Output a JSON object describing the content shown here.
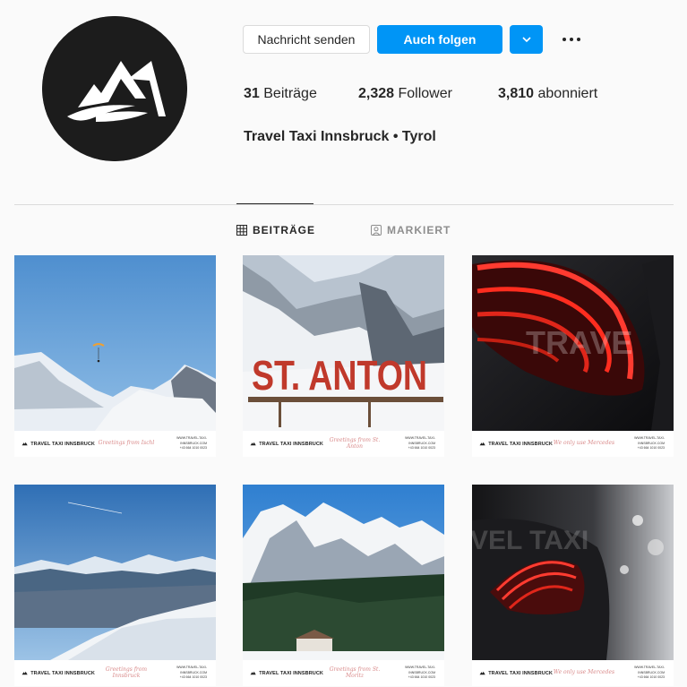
{
  "profile": {
    "avatar_icon": "mountain-logo-icon",
    "full_name": "Travel Taxi Innsbruck • Tyrol",
    "stats": {
      "posts_count": "31",
      "posts_label": "Beiträge",
      "followers_count": "2,328",
      "followers_label": "Follower",
      "following_count": "3,810",
      "following_label": "abonniert"
    }
  },
  "actions": {
    "message_label": "Nachricht senden",
    "follow_label": "Auch folgen",
    "dropdown_icon": "chevron-down-icon",
    "more_icon": "more-options-icon",
    "accent_color": "#0095f6"
  },
  "tabs": {
    "posts_label": "BEITRÄGE",
    "posts_icon": "grid-icon",
    "tagged_label": "MARKIERT",
    "tagged_icon": "tagged-user-icon"
  },
  "posts": [
    {
      "brand": "TRAVEL TAXI INNSBRUCK",
      "greeting": "Greetings from Ischl",
      "contact_1": "WWW.TRAVEL-TAXI-INNSBRUCK.COM",
      "contact_2": "+43 664 1010 0023"
    },
    {
      "sign_text": "ST. ANTON",
      "brand": "TRAVEL TAXI INNSBRUCK",
      "greeting": "Greetings from St. Anton",
      "contact_1": "WWW.TRAVEL-TAXI-INNSBRUCK.COM",
      "contact_2": "+43 664 1010 0023"
    },
    {
      "watermark": "TRAVE",
      "brand": "TRAVEL TAXI INNSBRUCK",
      "greeting": "We only use Mercedes",
      "contact_1": "WWW.TRAVEL-TAXI-INNSBRUCK.COM",
      "contact_2": "+43 664 1010 0023"
    },
    {
      "brand": "TRAVEL TAXI INNSBRUCK",
      "greeting": "Greetings from Innsbruck",
      "contact_1": "WWW.TRAVEL-TAXI-INNSBRUCK.COM",
      "contact_2": "+43 664 1010 0023"
    },
    {
      "brand": "TRAVEL TAXI INNSBRUCK",
      "greeting": "Greetings from St. Moritz",
      "contact_1": "WWW.TRAVEL-TAXI-INNSBRUCK.COM",
      "contact_2": "+43 664 1010 0023"
    },
    {
      "watermark": "VEL TAXI",
      "brand": "TRAVEL TAXI INNSBRUCK",
      "greeting": "We only use Mercedes",
      "contact_1": "WWW.TRAVEL-TAXI-INNSBRUCK.COM",
      "contact_2": "+43 664 1010 0023"
    }
  ]
}
